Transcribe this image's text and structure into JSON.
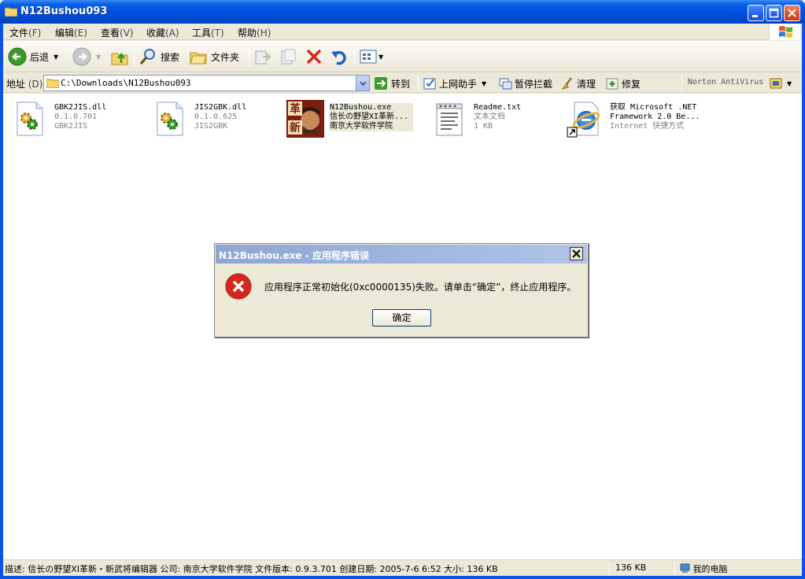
{
  "window": {
    "title": "N12Bushou093"
  },
  "menu": [
    {
      "label": "文件",
      "acc": "(F)"
    },
    {
      "label": "编辑",
      "acc": "(E)"
    },
    {
      "label": "查看",
      "acc": "(V)"
    },
    {
      "label": "收藏",
      "acc": "(A)"
    },
    {
      "label": "工具",
      "acc": "(T)"
    },
    {
      "label": "帮助",
      "acc": "(H)"
    }
  ],
  "toolbar": {
    "back": "后退",
    "search": "搜索",
    "folders": "文件夹"
  },
  "address": {
    "label": "地址",
    "acc": "(D)",
    "path": "C:\\Downloads\\N12Bushou093",
    "go": "转到",
    "helper": "上网助手",
    "popup_block": "暂停拦截",
    "clean": "清理",
    "repair": "修复",
    "norton": "Norton AntiVirus"
  },
  "files": [
    {
      "name": "GBK2JIS.dll",
      "line2": "0.1.0.701",
      "line3": "GBK2JIS",
      "icon": "dll-gear-icon"
    },
    {
      "name": "JIS2GBK.dll",
      "line2": "0.1.0.625",
      "line3": "JIS2GBK",
      "icon": "dll-gear-icon"
    },
    {
      "name": "N12Bushou.exe",
      "line2": "信长の野望XI革新...",
      "line3": "南京大学软件学院",
      "icon": "warrior-exe-icon"
    },
    {
      "name": "Readme.txt",
      "line2": "文本文档",
      "line3": "1 KB",
      "icon": "text-document-icon"
    },
    {
      "name": "获取 Microsoft .NET",
      "line2": "Framework 2.0 Be...",
      "line3": "Internet 快捷方式",
      "icon": "internet-shortcut-icon"
    }
  ],
  "dialog": {
    "title": "N12Bushou.exe - 应用程序错误",
    "message": "应用程序正常初始化(0xc0000135)失败。请单击“确定”，终止应用程序。",
    "ok": "确定"
  },
  "status": {
    "description": "描述: 信长の野望XI革新・新武将编辑器 公司: 南京大学软件学院 文件版本: 0.9.3.701 创建日期: 2005-7-6 6:52 大小: 136 KB",
    "size": "136 KB",
    "location": "我的电脑"
  },
  "colors": {
    "titlebar": "#0054e3",
    "chrome": "#ece9d8",
    "selection": "#ece9d8",
    "error": "#d7261e"
  }
}
